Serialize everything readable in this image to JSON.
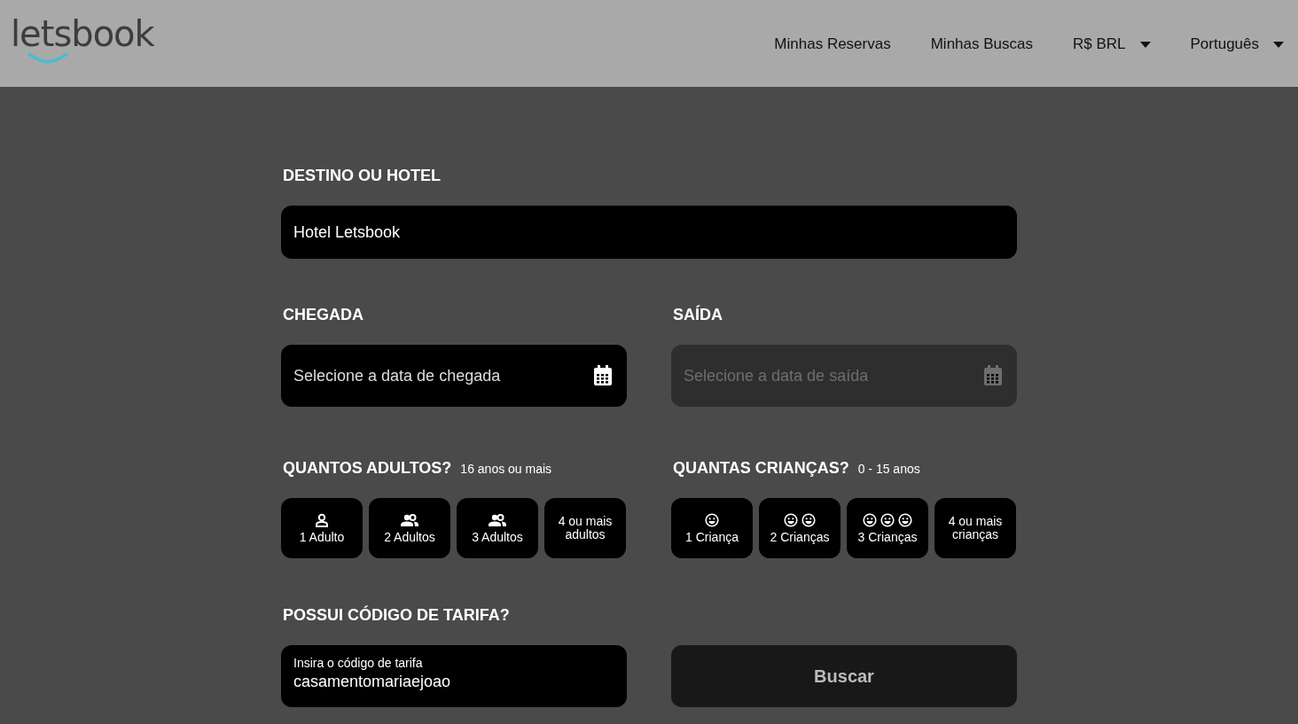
{
  "header": {
    "logo": "letsbook",
    "nav": [
      {
        "label": "Minhas Reservas",
        "kind": "link"
      },
      {
        "label": "Minhas Buscas",
        "kind": "link"
      },
      {
        "label": "R$ BRL",
        "kind": "dropdown"
      },
      {
        "label": "Português",
        "kind": "dropdown"
      }
    ]
  },
  "destination": {
    "label": "DESTINO OU HOTEL",
    "value": "Hotel Letsbook"
  },
  "dates": [
    {
      "label": "CHEGADA",
      "placeholder": "Selecione a data de chegada",
      "disabled": false
    },
    {
      "label": "SAÍDA",
      "placeholder": "Selecione a data de saída",
      "disabled": true
    }
  ],
  "guests": [
    {
      "label": "QUANTOS ADULTOS?",
      "hint": "16 anos ou mais",
      "options": [
        {
          "label": "1 Adulto",
          "kind": "person"
        },
        {
          "label": "2 Adultos",
          "kind": "people"
        },
        {
          "label": "3 Adultos",
          "kind": "people"
        },
        {
          "label": "4 ou mais adultos",
          "kind": "plain"
        }
      ]
    },
    {
      "label": "QUANTAS CRIANÇAS?",
      "hint": "0 - 15 anos",
      "options": [
        {
          "label": "1 Criança",
          "kind": "face-1"
        },
        {
          "label": "2 Crianças",
          "kind": "face-2"
        },
        {
          "label": "3 Crianças",
          "kind": "face-3"
        },
        {
          "label": "4 ou mais crianças",
          "kind": "plain"
        }
      ]
    }
  ],
  "rate_code": {
    "label": "POSSUI CÓDIGO DE TARIFA?",
    "placeholder": "Insira o código de tarifa",
    "value": "casamentomariaejoao"
  },
  "search_button": {
    "label": "Buscar",
    "disabled": true
  }
}
